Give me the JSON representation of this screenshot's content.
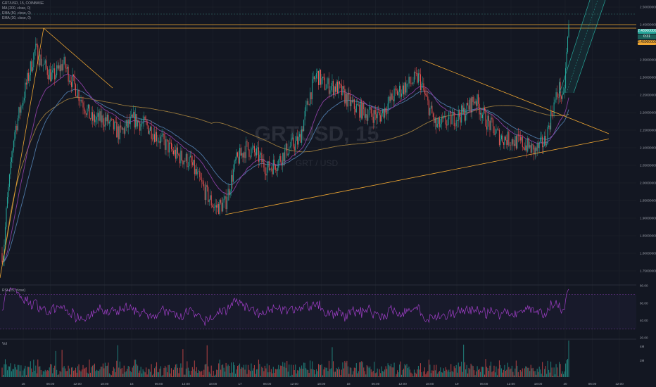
{
  "legend": {
    "symbol": "GRT/USD, 15, COINBASE",
    "lines": [
      "MA (200, close, 0)",
      "EMA (50, close, 0)",
      "EMA (30, close, 0)"
    ]
  },
  "watermark": {
    "ticker": "GRTUSD, 15",
    "name": "GRT / USD"
  },
  "price_tags": [
    {
      "text": "2.48000000",
      "color": "#26a69a"
    },
    {
      "text": "0:31",
      "color": "#26a69a"
    },
    {
      "text": "2.45000000",
      "color": "#f0a732"
    }
  ],
  "rsi": {
    "label": "RSI (15, close)"
  },
  "volume": {
    "label": "Vol"
  },
  "chart_data": [
    {
      "type": "candlestick",
      "title": "GRT/USD, 15, COINBASE",
      "ylim": [
        1.72,
        2.52
      ],
      "y_ticks": [
        "2.50000000",
        "2.45000000",
        "2.40000000",
        "2.35000000",
        "2.30000000",
        "2.25000000",
        "2.20000000",
        "2.15000000",
        "2.10000000",
        "2.05000000",
        "2.00000000",
        "1.95000000",
        "1.90000000",
        "1.85000000",
        "1.80000000",
        "1.75000000"
      ],
      "x_ticks": [
        "15",
        "06:00",
        "12:00",
        "18:00",
        "16",
        "06:00",
        "12:00",
        "18:00",
        "17",
        "06:00",
        "12:00",
        "18:00",
        "18",
        "06:00",
        "12:00",
        "18:00",
        "19",
        "06:00",
        "12:00",
        "18:00",
        "20",
        "06:00",
        "12:00"
      ],
      "price_anchors": [
        [
          0,
          1.86
        ],
        [
          4,
          1.78
        ],
        [
          10,
          1.94
        ],
        [
          20,
          2.14
        ],
        [
          35,
          2.26
        ],
        [
          50,
          2.38
        ],
        [
          60,
          2.34
        ],
        [
          75,
          2.3
        ],
        [
          90,
          2.34
        ],
        [
          110,
          2.26
        ],
        [
          130,
          2.18
        ],
        [
          150,
          2.18
        ],
        [
          170,
          2.14
        ],
        [
          190,
          2.18
        ],
        [
          210,
          2.16
        ],
        [
          230,
          2.12
        ],
        [
          250,
          2.08
        ],
        [
          270,
          2.06
        ],
        [
          290,
          1.98
        ],
        [
          305,
          1.93
        ],
        [
          320,
          1.94
        ],
        [
          335,
          2.06
        ],
        [
          350,
          2.1
        ],
        [
          365,
          2.08
        ],
        [
          380,
          2.04
        ],
        [
          395,
          2.06
        ],
        [
          410,
          2.1
        ],
        [
          425,
          2.12
        ],
        [
          440,
          2.25
        ],
        [
          450,
          2.31
        ],
        [
          460,
          2.28
        ],
        [
          480,
          2.27
        ],
        [
          500,
          2.22
        ],
        [
          520,
          2.2
        ],
        [
          540,
          2.19
        ],
        [
          560,
          2.25
        ],
        [
          580,
          2.28
        ],
        [
          595,
          2.3
        ],
        [
          605,
          2.24
        ],
        [
          620,
          2.16
        ],
        [
          640,
          2.18
        ],
        [
          660,
          2.2
        ],
        [
          675,
          2.24
        ],
        [
          690,
          2.18
        ],
        [
          710,
          2.13
        ],
        [
          730,
          2.12
        ],
        [
          745,
          2.11
        ],
        [
          760,
          2.09
        ],
        [
          775,
          2.12
        ],
        [
          785,
          2.21
        ],
        [
          795,
          2.27
        ],
        [
          800,
          2.22
        ],
        [
          808,
          2.45
        ]
      ],
      "levels": [
        2.45,
        2.44,
        2.48
      ],
      "trend_lines": [
        {
          "name": "upper-triangle",
          "points": [
            [
              600,
              2.35
            ],
            [
              865,
              2.14
            ]
          ]
        },
        {
          "name": "lower-triangle",
          "points": [
            [
              320,
              1.91
            ],
            [
              865,
              2.125
            ]
          ]
        },
        {
          "name": "left-descending",
          "points": [
            [
              62,
              2.44
            ],
            [
              160,
              2.27
            ]
          ]
        },
        {
          "name": "left-ascending",
          "points": [
            [
              0,
              1.73
            ],
            [
              62,
              2.44
            ]
          ]
        }
      ],
      "ma_series": [
        {
          "name": "MA (200, close, 0)",
          "color": "#9a7a3c"
        },
        {
          "name": "EMA (50, close, 0)",
          "color": "#4e79a7"
        },
        {
          "name": "EMA (30, close, 0)",
          "color": "#8a3ea0"
        }
      ],
      "colors": {
        "up": "#26a69a",
        "down": "#ef5350"
      }
    },
    {
      "type": "line",
      "title": "RSI (15, close)",
      "ylim": [
        20,
        80
      ],
      "y_ticks": [
        "80.00",
        "60.00",
        "40.00",
        "20.00"
      ],
      "bands": [
        70,
        30
      ],
      "colors": {
        "line": "#a03ec8",
        "band": "#7a3ea0"
      }
    },
    {
      "type": "bar",
      "title": "Vol",
      "y_ticks": [
        "4M",
        "2M"
      ],
      "colors": {
        "up": "#26a69a",
        "down": "#ef5350"
      }
    }
  ]
}
